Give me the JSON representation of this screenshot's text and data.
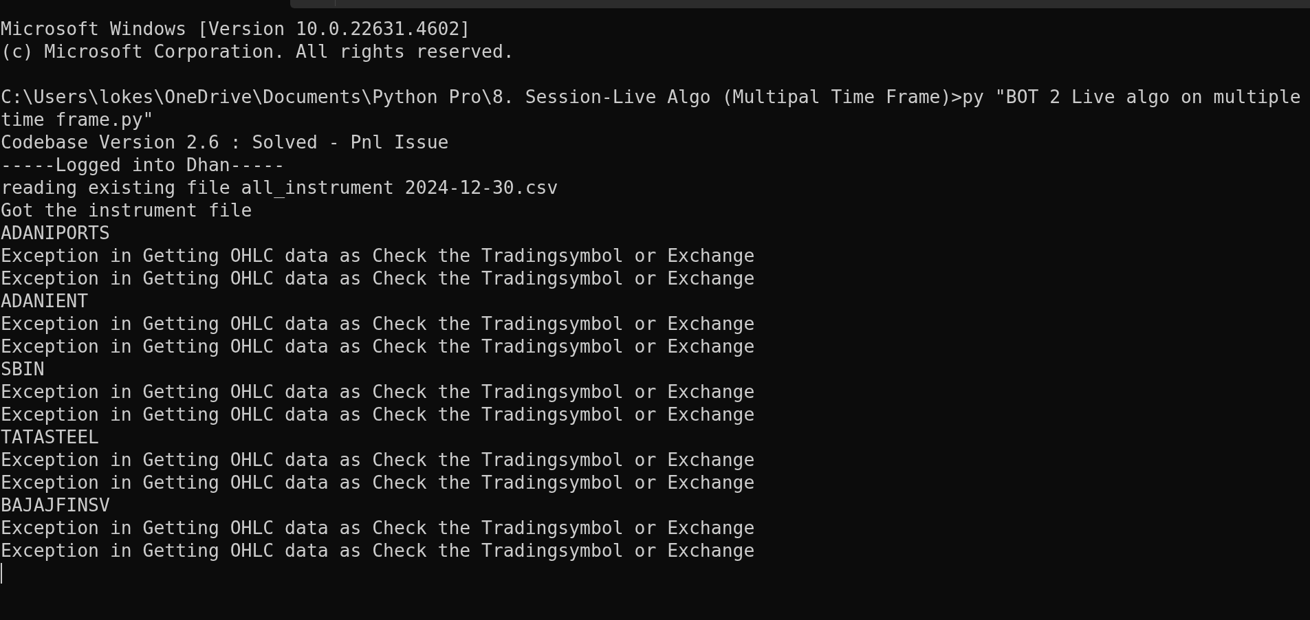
{
  "console": {
    "lines": [
      {
        "kind": "text",
        "text": "Microsoft Windows [Version 10.0.22631.4602]"
      },
      {
        "kind": "text",
        "text": "(c) Microsoft Corporation. All rights reserved."
      },
      {
        "kind": "blank"
      },
      {
        "kind": "text",
        "text": "C:\\Users\\lokes\\OneDrive\\Documents\\Python Pro\\8. Session-Live Algo (Multipal Time Frame)>py \"BOT 2 Live algo on multiple"
      },
      {
        "kind": "text",
        "text": "time frame.py\""
      },
      {
        "kind": "text",
        "text": "Codebase Version 2.6 : Solved - Pnl Issue"
      },
      {
        "kind": "text",
        "text": "-----Logged into Dhan-----"
      },
      {
        "kind": "text",
        "text": "reading existing file all_instrument 2024-12-30.csv"
      },
      {
        "kind": "text",
        "text": "Got the instrument file"
      },
      {
        "kind": "text",
        "text": "ADANIPORTS"
      },
      {
        "kind": "text",
        "text": "Exception in Getting OHLC data as Check the Tradingsymbol or Exchange"
      },
      {
        "kind": "text",
        "text": "Exception in Getting OHLC data as Check the Tradingsymbol or Exchange"
      },
      {
        "kind": "text",
        "text": "ADANIENT"
      },
      {
        "kind": "text",
        "text": "Exception in Getting OHLC data as Check the Tradingsymbol or Exchange"
      },
      {
        "kind": "text",
        "text": "Exception in Getting OHLC data as Check the Tradingsymbol or Exchange"
      },
      {
        "kind": "text",
        "text": "SBIN"
      },
      {
        "kind": "text",
        "text": "Exception in Getting OHLC data as Check the Tradingsymbol or Exchange"
      },
      {
        "kind": "text",
        "text": "Exception in Getting OHLC data as Check the Tradingsymbol or Exchange"
      },
      {
        "kind": "text",
        "text": "TATASTEEL"
      },
      {
        "kind": "text",
        "text": "Exception in Getting OHLC data as Check the Tradingsymbol or Exchange"
      },
      {
        "kind": "text",
        "text": "Exception in Getting OHLC data as Check the Tradingsymbol or Exchange"
      },
      {
        "kind": "text",
        "text": "BAJAJFINSV"
      },
      {
        "kind": "text",
        "text": "Exception in Getting OHLC data as Check the Tradingsymbol or Exchange"
      },
      {
        "kind": "text",
        "text": "Exception in Getting OHLC data as Check the Tradingsymbol or Exchange"
      }
    ],
    "cursor_visible": true
  }
}
